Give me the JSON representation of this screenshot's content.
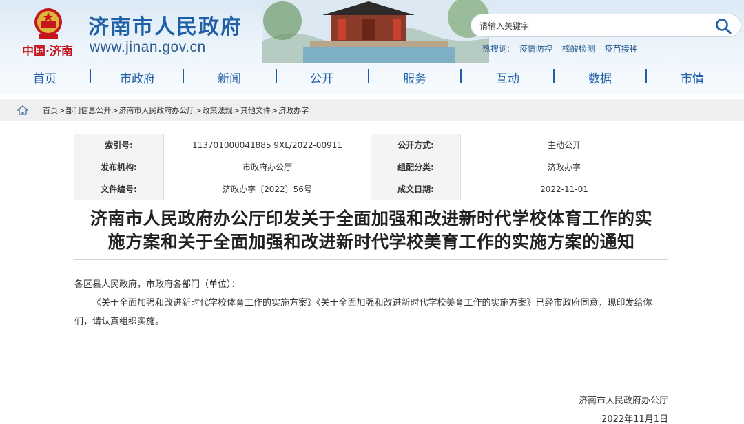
{
  "header": {
    "site_name": "济南市人民政府",
    "slogan": "中国·济南",
    "url": "www.jinan.gov.cn",
    "search_placeholder": "请输入关键字",
    "hot_label": "热搜词:",
    "hot_words": [
      "疫情防控",
      "核酸检测",
      "疫苗接种"
    ],
    "nav": [
      "首页",
      "市政府",
      "新闻",
      "公开",
      "服务",
      "互动",
      "数据",
      "市情"
    ],
    "brand_color": "#1f5fa8",
    "slogan_color": "#c4161c"
  },
  "breadcrumb": [
    "首页",
    "部门信息公开",
    "济南市人民政府办公厅",
    "政策法规",
    "其他文件",
    "济政办字"
  ],
  "info": {
    "index_label": "索引号:",
    "index_value": "113701000041885 9XL/2022-00911",
    "open_mode_label": "公开方式:",
    "open_mode_value": "主动公开",
    "publisher_label": "发布机构:",
    "publisher_value": "市政府办公厅",
    "category_label": "组配分类:",
    "category_value": "济政办字",
    "doc_no_label": "文件编号:",
    "doc_no_value": "济政办字〔2022〕56号",
    "date_label": "成文日期:",
    "date_value": "2022-11-01"
  },
  "doc": {
    "title_line1": "济南市人民政府办公厅印发关于全面加强和改进新时代学校体育工作的实",
    "title_line2": "施方案和关于全面加强和改进新时代学校美育工作的实施方案的通知",
    "salutation": "各区县人民政府，市政府各部门（单位）：",
    "para1": "《关于全面加强和改进新时代学校体育工作的实施方案》《关于全面加强和改进新时代学校美育工作的实施方案》已经市政府同意，现印发给你们，请认真组织实施。",
    "sign_org": "济南市人民政府办公厅",
    "sign_date": "2022年11月1日"
  }
}
